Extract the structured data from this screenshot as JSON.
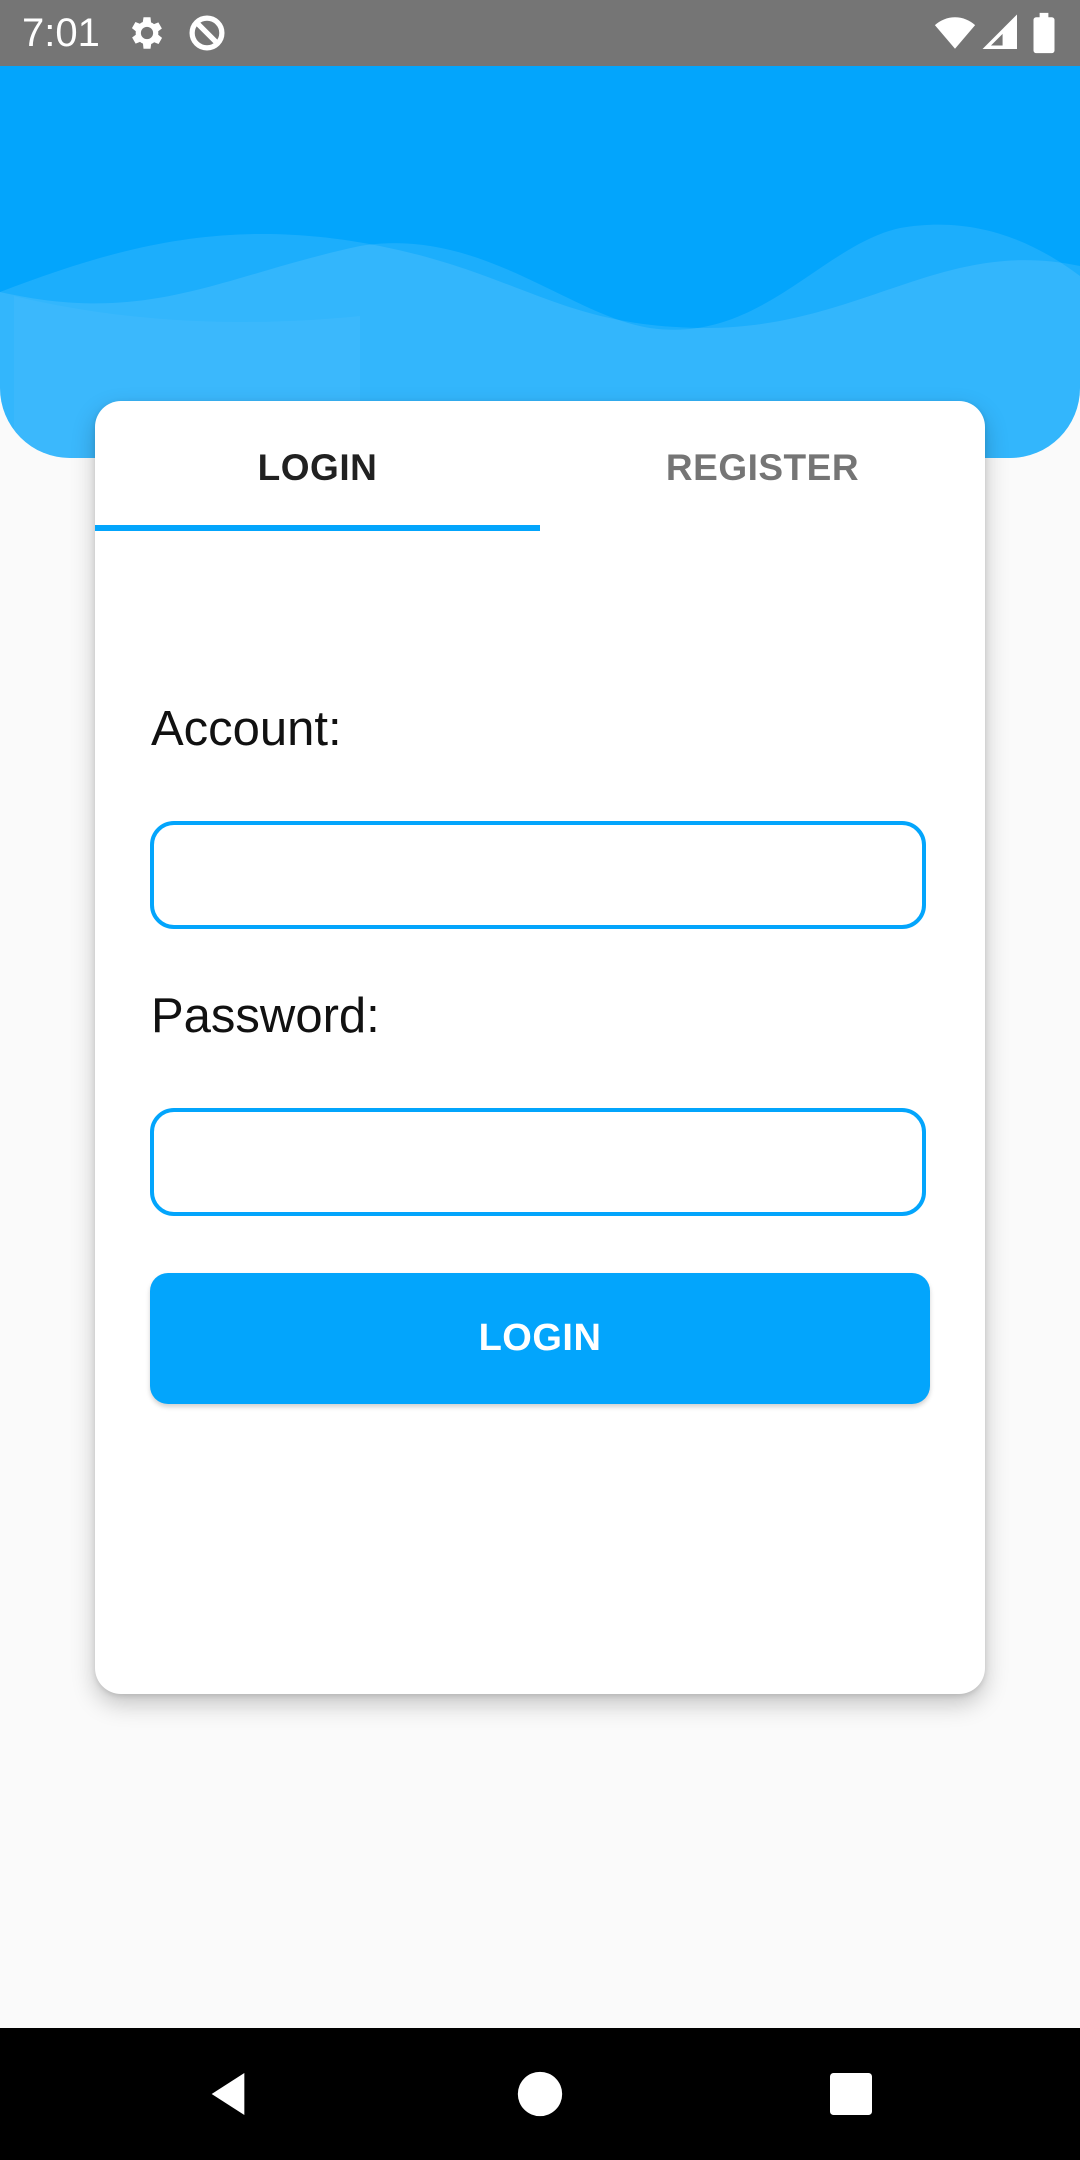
{
  "status_bar": {
    "time": "7:01",
    "left_icons": [
      "settings-gear-icon",
      "data-saver-icon"
    ],
    "right_icons": [
      "wifi-icon",
      "cell-signal-icon",
      "battery-icon"
    ]
  },
  "tabs": [
    {
      "label": "LOGIN",
      "selected": true
    },
    {
      "label": "REGISTER",
      "selected": false
    }
  ],
  "form": {
    "account_label": "Account:",
    "account_value": "",
    "password_label": "Password:",
    "password_value": "",
    "submit_label": "LOGIN"
  },
  "nav_bar": {
    "icons": [
      "back-icon",
      "home-icon",
      "recents-icon"
    ]
  },
  "colors": {
    "accent": "#03a5fc",
    "status_bar": "#757575",
    "background": "#fafafa"
  }
}
